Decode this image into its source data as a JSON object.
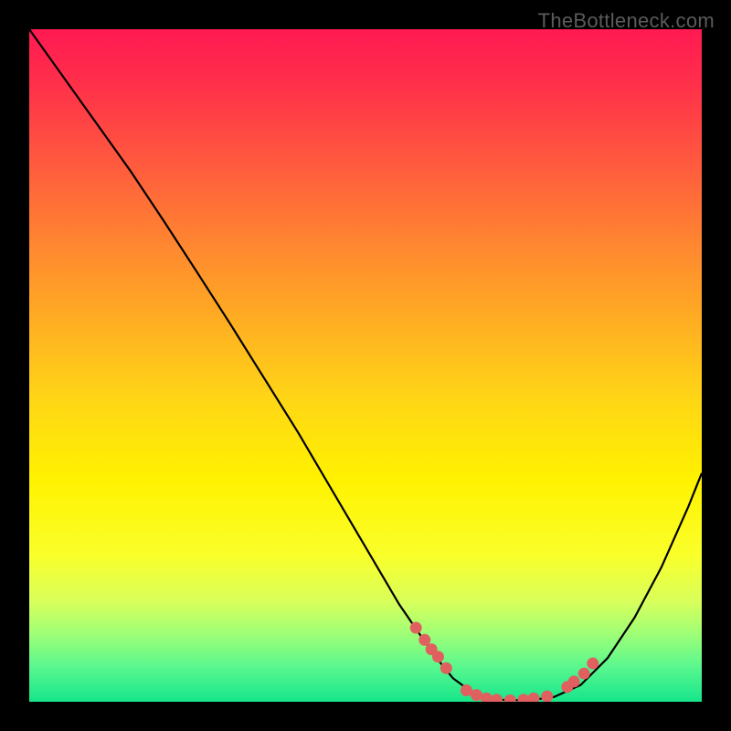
{
  "watermark": "TheBottleneck.com",
  "chart_data": {
    "type": "line",
    "title": "",
    "xlabel": "",
    "ylabel": "",
    "xlim": [
      0,
      100
    ],
    "ylim": [
      0,
      100
    ],
    "series": [
      {
        "name": "curve",
        "x": [
          0,
          5,
          10,
          15,
          20,
          25,
          30,
          35,
          40,
          45,
          50,
          55,
          60,
          63,
          66,
          70,
          74,
          78,
          82,
          86,
          90,
          94,
          98,
          100
        ],
        "y": [
          100,
          93,
          86,
          79,
          71.5,
          63.8,
          56,
          48,
          40,
          31.5,
          23,
          14.5,
          7.2,
          3.5,
          1.3,
          0.3,
          0.2,
          0.7,
          2.5,
          6.5,
          12.5,
          20,
          29,
          34
        ]
      }
    ],
    "points": {
      "name": "markers",
      "x": [
        57.5,
        58.8,
        59.8,
        60.8,
        62.0,
        65.0,
        66.5,
        68.0,
        69.5,
        71.5,
        73.5,
        75.0,
        77.0,
        80.0,
        81.0,
        82.5,
        83.8
      ],
      "y": [
        11.0,
        9.2,
        7.8,
        6.7,
        5.0,
        1.7,
        1.0,
        0.5,
        0.3,
        0.2,
        0.3,
        0.5,
        0.8,
        2.2,
        3.0,
        4.2,
        5.7
      ]
    }
  }
}
